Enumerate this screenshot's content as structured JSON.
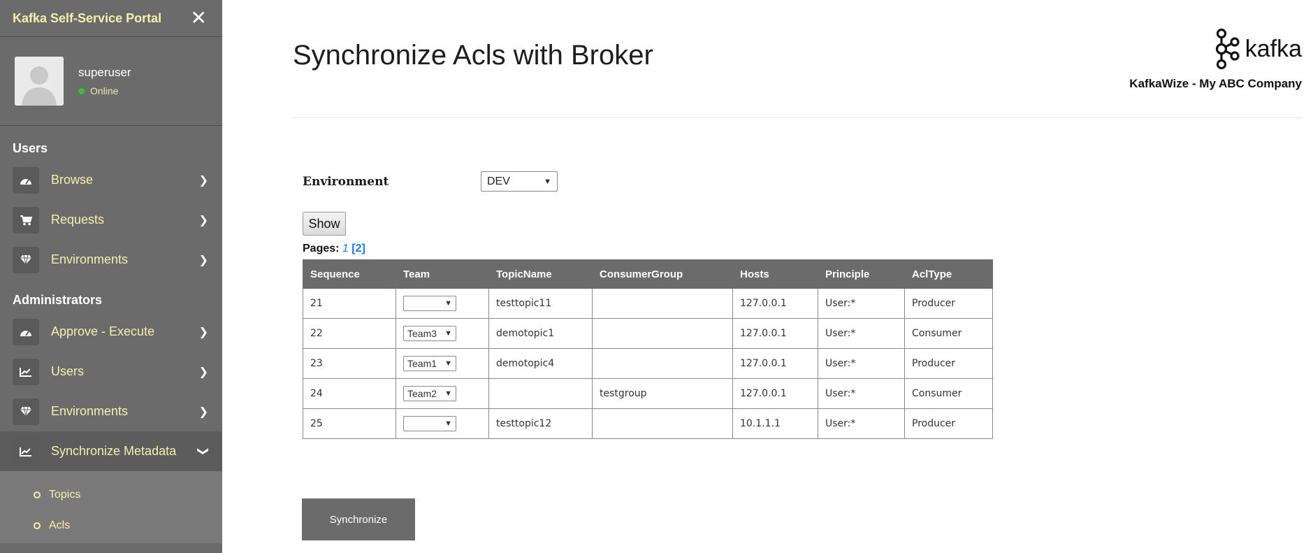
{
  "sidebar": {
    "brand": "Kafka Self-Service Portal",
    "close_glyph": "✕",
    "user": {
      "name": "superuser",
      "status": "Online"
    },
    "sections": [
      {
        "title": "Users",
        "items": [
          {
            "label": "Browse",
            "icon": "dashboard-icon"
          },
          {
            "label": "Requests",
            "icon": "cart-icon"
          },
          {
            "label": "Environments",
            "icon": "diamond-icon"
          }
        ]
      },
      {
        "title": "Administrators",
        "items": [
          {
            "label": "Approve - Execute",
            "icon": "dashboard-icon"
          },
          {
            "label": "Users",
            "icon": "chart-icon"
          },
          {
            "label": "Environments",
            "icon": "diamond-icon"
          },
          {
            "label": "Synchronize Metadata",
            "icon": "chart-icon",
            "expanded": true
          }
        ]
      }
    ],
    "submenu": [
      {
        "label": "Topics"
      },
      {
        "label": "Acls"
      }
    ]
  },
  "header": {
    "title": "Synchronize Acls with Broker",
    "logo_text": "kafka",
    "company": "KafkaWize - My ABC Company"
  },
  "form": {
    "environment_label": "Environment",
    "environment_value": "DEV",
    "show_label": "Show"
  },
  "pagination": {
    "label": "Pages:",
    "current": "1",
    "next": "[2]"
  },
  "table": {
    "columns": [
      "Sequence",
      "Team",
      "TopicName",
      "ConsumerGroup",
      "Hosts",
      "Principle",
      "AclType"
    ],
    "rows": [
      {
        "sequence": "21",
        "team": "",
        "topic": "testtopic11",
        "group": "",
        "host": "127.0.0.1",
        "principle": "User:*",
        "type": "Producer"
      },
      {
        "sequence": "22",
        "team": "Team3",
        "topic": "demotopic1",
        "group": "",
        "host": "127.0.0.1",
        "principle": "User:*",
        "type": "Consumer"
      },
      {
        "sequence": "23",
        "team": "Team1",
        "topic": "demotopic4",
        "group": "",
        "host": "127.0.0.1",
        "principle": "User:*",
        "type": "Producer"
      },
      {
        "sequence": "24",
        "team": "Team2",
        "topic": "",
        "group": "testgroup",
        "host": "127.0.0.1",
        "principle": "User:*",
        "type": "Consumer"
      },
      {
        "sequence": "25",
        "team": "",
        "topic": "testtopic12",
        "group": "",
        "host": "10.1.1.1",
        "principle": "User:*",
        "type": "Producer"
      }
    ]
  },
  "actions": {
    "synchronize_label": "Synchronize"
  },
  "colors": {
    "sidebar_bg": "#6b6b6b",
    "accent_text": "#f5efb0",
    "link": "#1f7ae0",
    "online": "#3bbf3b"
  }
}
